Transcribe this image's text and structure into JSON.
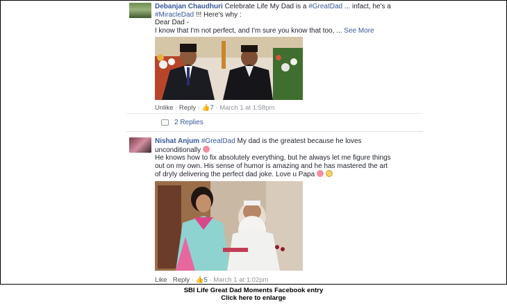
{
  "comments": [
    {
      "author": "Debanjan Chaudhuri",
      "lines": [
        [
          "Celebrate Life My Dad is a ",
          "#GreatDad",
          " ... infact, he's a"
        ],
        [
          "",
          "#MiracleDad",
          " !!! Here's why :"
        ],
        [
          "Dear Dad -",
          "",
          ""
        ],
        [
          "I know that I'm not perfect, and I'm sure you know that too, ... ",
          "",
          ""
        ]
      ],
      "see_more": "See More",
      "actions": {
        "like": "Unlike",
        "reply": "Reply",
        "likes": "7",
        "time": "March 1 at 1:58pm"
      },
      "replies": "2 Replies"
    },
    {
      "author": "Nishat Anjum",
      "lines": [
        [
          "",
          "#GreatDad",
          " My dad is the greatest because he loves"
        ],
        [
          "unconditionally",
          "",
          ""
        ],
        [
          "He knows how to fix absolutely everything, but he always let me figure things",
          "",
          ""
        ],
        [
          "out on my own. His sense of humor is amazing and he has mastered the art",
          "",
          ""
        ],
        [
          "of dryly delivering the perfect dad joke. Love u Papa",
          "",
          ""
        ]
      ],
      "actions": {
        "like": "Like",
        "reply": "Reply",
        "likes": "5",
        "time": "March 1 at 1:02pm"
      }
    }
  ],
  "caption": {
    "line1": "SBI Life Great Dad Moments Facebook entry",
    "line2": "Click here to enlarge"
  }
}
